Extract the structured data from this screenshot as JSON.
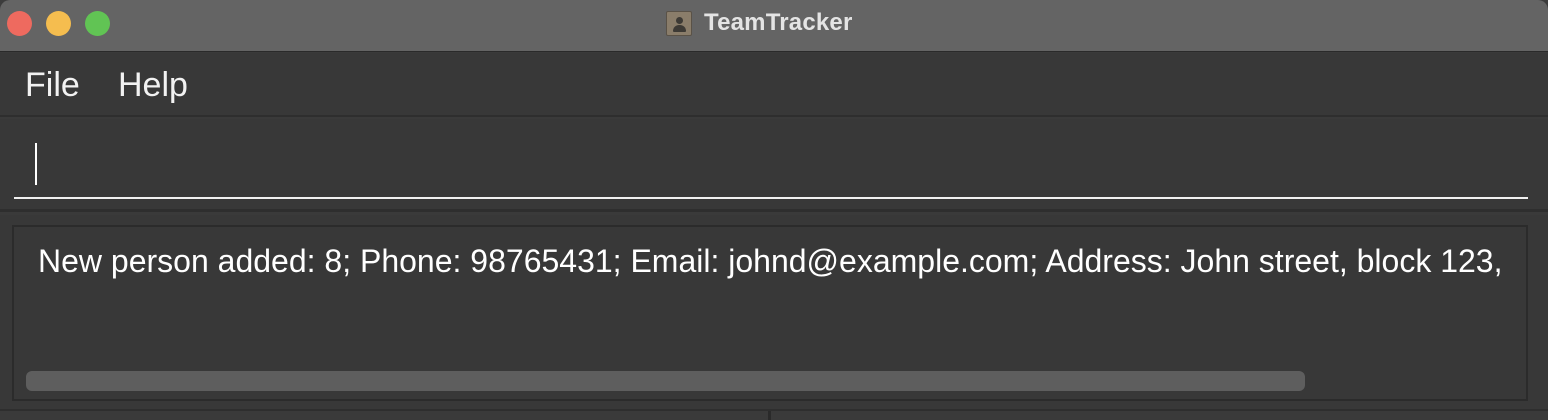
{
  "window": {
    "title": "TeamTracker",
    "app_icon": "contact-book-icon"
  },
  "menubar": {
    "items": [
      {
        "label": "File"
      },
      {
        "label": "Help"
      }
    ]
  },
  "command_box": {
    "value": "",
    "placeholder": ""
  },
  "result_display": {
    "text": "New person added: 8; Phone: 98765431; Email: johnd@example.com; Address: John street, block 123,"
  },
  "colors": {
    "close": "#ee6a5f",
    "minimize": "#f5bd4f",
    "maximize": "#61c454",
    "background": "#383838",
    "text": "#ffffff"
  }
}
